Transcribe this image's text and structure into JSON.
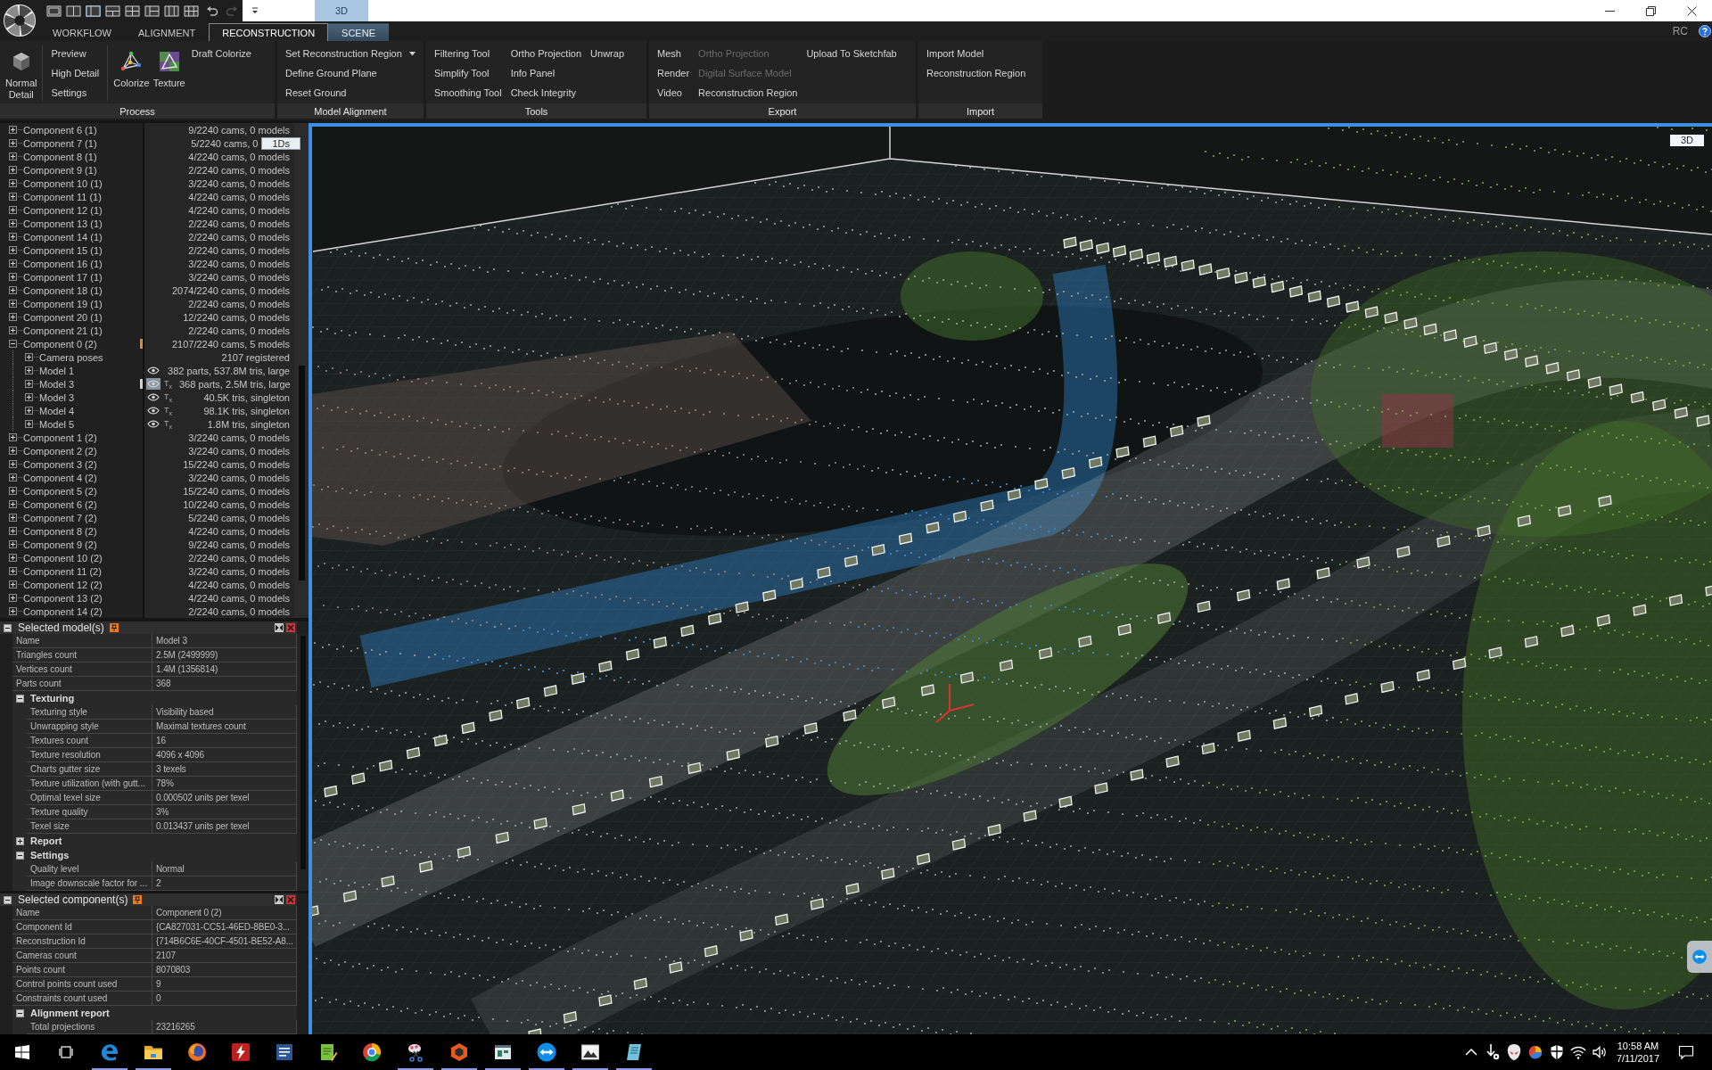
{
  "quick_access": {
    "layouts": [
      {
        "selected": false
      },
      {
        "selected": false
      },
      {
        "selected": true
      },
      {
        "selected": false
      },
      {
        "selected": false
      },
      {
        "selected": false
      },
      {
        "selected": false
      },
      {
        "selected": false
      }
    ],
    "history": [
      {
        "disabled": false
      },
      {
        "disabled": true
      }
    ]
  },
  "context_tab_group": {
    "label": "3D"
  },
  "tabs": [
    {
      "label": "WORKFLOW",
      "selected": false,
      "contextual": false
    },
    {
      "label": "ALIGNMENT",
      "selected": false,
      "contextual": false
    },
    {
      "label": "RECONSTRUCTION",
      "selected": true,
      "contextual": false
    },
    {
      "label": "SCENE",
      "selected": false,
      "contextual": true
    }
  ],
  "app_badge": "RC",
  "ribbon": {
    "groups": [
      {
        "label": "Process",
        "items": [
          {
            "kind": "large",
            "label": "Normal Detail"
          },
          {
            "kind": "separator"
          },
          {
            "kind": "stack",
            "buttons": [
              {
                "label": "Preview",
                "kind": "button",
                "disabled": false
              },
              {
                "label": "High Detail",
                "kind": "button",
                "disabled": false
              },
              {
                "label": "Settings",
                "kind": "button",
                "disabled": false
              }
            ]
          },
          {
            "kind": "separator"
          },
          {
            "kind": "large",
            "label": "Colorize"
          },
          {
            "kind": "large",
            "label": "Texture"
          },
          {
            "kind": "stack",
            "buttons": [
              {
                "label": "Draft Colorize",
                "kind": "button",
                "disabled": false
              }
            ]
          }
        ]
      },
      {
        "label": "Model Alignment",
        "items": [
          {
            "kind": "stack",
            "buttons": [
              {
                "label": "Set Reconstruction Region",
                "kind": "dropdown",
                "disabled": false
              },
              {
                "label": "Define Ground Plane",
                "kind": "button",
                "disabled": false
              },
              {
                "label": "Reset Ground",
                "kind": "button",
                "disabled": false
              }
            ]
          }
        ]
      },
      {
        "label": "Tools",
        "items": [
          {
            "kind": "stack",
            "buttons": [
              {
                "label": "Filtering Tool",
                "kind": "button",
                "disabled": false
              },
              {
                "label": "Simplify Tool",
                "kind": "button",
                "disabled": false
              },
              {
                "label": "Smoothing Tool",
                "kind": "button",
                "disabled": false
              }
            ]
          },
          {
            "kind": "stack",
            "buttons": [
              {
                "label": "Ortho Projection",
                "kind": "button",
                "disabled": false
              },
              {
                "label": "Info Panel",
                "kind": "button",
                "disabled": false
              },
              {
                "label": "Check Integrity",
                "kind": "button",
                "disabled": false
              }
            ]
          },
          {
            "kind": "stack",
            "buttons": [
              {
                "label": "Unwrap",
                "kind": "button",
                "disabled": false
              }
            ]
          }
        ]
      },
      {
        "label": "Export",
        "items": [
          {
            "kind": "stack",
            "buttons": [
              {
                "label": "Mesh",
                "kind": "button",
                "disabled": false
              },
              {
                "label": "Render",
                "kind": "button",
                "disabled": false
              },
              {
                "label": "Video",
                "kind": "button",
                "disabled": false
              }
            ]
          },
          {
            "kind": "stack",
            "buttons": [
              {
                "label": "Ortho Projection",
                "kind": "button",
                "disabled": true
              },
              {
                "label": "Digital Surface Model",
                "kind": "button",
                "disabled": true
              },
              {
                "label": "Reconstruction Region",
                "kind": "button",
                "disabled": false
              }
            ]
          },
          {
            "kind": "stack",
            "buttons": [
              {
                "label": "Upload To Sketchfab",
                "kind": "button",
                "disabled": false
              }
            ]
          }
        ]
      },
      {
        "label": "Import",
        "items": [
          {
            "kind": "stack",
            "buttons": [
              {
                "label": "Import Model",
                "kind": "button",
                "disabled": false
              },
              {
                "label": "Reconstruction Region",
                "kind": "button",
                "disabled": false
              }
            ]
          }
        ]
      }
    ]
  },
  "tree": {
    "rows": [
      {
        "label": "Component 6 (1)",
        "info": "9/2240 cams, 0 models",
        "expanded": false,
        "selected": false
      },
      {
        "label": "Component 7 (1)",
        "info": "5/2240 cams, 0",
        "tooltip": "1Ds",
        "expanded": false,
        "selected": false
      },
      {
        "label": "Component 8 (1)",
        "info": "4/2240 cams, 0 models",
        "expanded": false,
        "selected": false
      },
      {
        "label": "Component 9 (1)",
        "info": "2/2240 cams, 0 models",
        "expanded": false,
        "selected": false
      },
      {
        "label": "Component 10 (1)",
        "info": "3/2240 cams, 0 models",
        "expanded": false,
        "selected": false
      },
      {
        "label": "Component 11 (1)",
        "info": "4/2240 cams, 0 models",
        "expanded": false,
        "selected": false
      },
      {
        "label": "Component 12 (1)",
        "info": "4/2240 cams, 0 models",
        "expanded": false,
        "selected": false
      },
      {
        "label": "Component 13 (1)",
        "info": "2/2240 cams, 0 models",
        "expanded": false,
        "selected": false
      },
      {
        "label": "Component 14 (1)",
        "info": "2/2240 cams, 0 models",
        "expanded": false,
        "selected": false
      },
      {
        "label": "Component 15 (1)",
        "info": "2/2240 cams, 0 models",
        "expanded": false,
        "selected": false
      },
      {
        "label": "Component 16 (1)",
        "info": "3/2240 cams, 0 models",
        "expanded": false,
        "selected": false
      },
      {
        "label": "Component 17 (1)",
        "info": "3/2240 cams, 0 models",
        "expanded": false,
        "selected": false
      },
      {
        "label": "Component 18 (1)",
        "info": "2074/2240 cams, 0 models",
        "expanded": false,
        "selected": false
      },
      {
        "label": "Component 19 (1)",
        "info": "2/2240 cams, 0 models",
        "expanded": false,
        "selected": false
      },
      {
        "label": "Component 20 (1)",
        "info": "12/2240 cams, 0 models",
        "expanded": false,
        "selected": false
      },
      {
        "label": "Component 21 (1)",
        "info": "2/2240 cams, 0 models",
        "expanded": false,
        "selected": false
      },
      {
        "label": "Component 0 (2)",
        "info": "2107/2240 cams, 5 models",
        "expanded": true,
        "selected": true,
        "children": [
          {
            "kind": "poses",
            "label": "Camera poses",
            "info": "2107 registered",
            "expanded": false,
            "selected": false
          },
          {
            "kind": "model",
            "label": "Model 1",
            "info": "382 parts, 537.8M tris, large",
            "expanded": false,
            "selected": false,
            "visible": true
          },
          {
            "kind": "model",
            "label": "Model 3",
            "info": "368 parts, 2.5M tris, large",
            "expanded": false,
            "selected": true,
            "visible": true,
            "badge": "T$_{x}$"
          },
          {
            "kind": "model",
            "label": "Model 3",
            "info": "40.5K tris, singleton",
            "expanded": false,
            "selected": false,
            "visible": true,
            "badge": "T$_{x}$"
          },
          {
            "kind": "model",
            "label": "Model 4",
            "info": "98.1K tris, singleton",
            "expanded": false,
            "selected": false,
            "visible": true,
            "badge": "T$_{x}$"
          },
          {
            "kind": "model",
            "label": "Model 5",
            "info": "1.8M tris, singleton",
            "expanded": false,
            "selected": false,
            "visible": true,
            "badge": "T$_{x}$"
          }
        ]
      },
      {
        "label": "Component 1 (2)",
        "info": "3/2240 cams, 0 models",
        "expanded": false,
        "selected": false
      },
      {
        "label": "Component 2 (2)",
        "info": "3/2240 cams, 0 models",
        "expanded": false,
        "selected": false
      },
      {
        "label": "Component 3 (2)",
        "info": "15/2240 cams, 0 models",
        "expanded": false,
        "selected": false
      },
      {
        "label": "Component 4 (2)",
        "info": "3/2240 cams, 0 models",
        "expanded": false,
        "selected": false
      },
      {
        "label": "Component 5 (2)",
        "info": "15/2240 cams, 0 models",
        "expanded": false,
        "selected": false
      },
      {
        "label": "Component 6 (2)",
        "info": "10/2240 cams, 0 models",
        "expanded": false,
        "selected": false
      },
      {
        "label": "Component 7 (2)",
        "info": "5/2240 cams, 0 models",
        "expanded": false,
        "selected": false
      },
      {
        "label": "Component 8 (2)",
        "info": "4/2240 cams, 0 models",
        "expanded": false,
        "selected": false
      },
      {
        "label": "Component 9 (2)",
        "info": "9/2240 cams, 0 models",
        "expanded": false,
        "selected": false
      },
      {
        "label": "Component 10 (2)",
        "info": "2/2240 cams, 0 models",
        "expanded": false,
        "selected": false
      },
      {
        "label": "Component 11 (2)",
        "info": "3/2240 cams, 0 models",
        "expanded": false,
        "selected": false
      },
      {
        "label": "Component 12 (2)",
        "info": "4/2240 cams, 0 models",
        "expanded": false,
        "selected": false
      },
      {
        "label": "Component 13 (2)",
        "info": "4/2240 cams, 0 models",
        "expanded": false,
        "selected": false
      },
      {
        "label": "Component 14 (2)",
        "info": "2/2240 cams, 0 models",
        "expanded": false,
        "selected": false
      }
    ]
  },
  "panels": [
    {
      "title": "Selected model(s)",
      "expanded": true,
      "rows": [
        {
          "kind": "property",
          "label": "Name",
          "value": "Model 3"
        },
        {
          "kind": "property",
          "label": "Triangles count",
          "value": "2.5M (2499999)"
        },
        {
          "kind": "property",
          "label": "Vertices count",
          "value": "1.4M (1356814)"
        },
        {
          "kind": "property",
          "label": "Parts count",
          "value": "368"
        },
        {
          "kind": "section",
          "label": "Texturing",
          "expanded": true,
          "children": [
            {
              "kind": "property",
              "label": "Texturing style",
              "value": "Visibility based"
            },
            {
              "kind": "property",
              "label": "Unwrapping style",
              "value": "Maximal textures count"
            },
            {
              "kind": "property",
              "label": "Textures count",
              "value": "16"
            },
            {
              "kind": "property",
              "label": "Texture resolution",
              "value": "4096 x 4096"
            },
            {
              "kind": "property",
              "label": "Charts gutter size",
              "value": "3 texels"
            },
            {
              "kind": "property",
              "label": "Texture utilization (with gutt...",
              "value": "78%"
            },
            {
              "kind": "property",
              "label": "Optimal texel size",
              "value": "0.000502 units per texel"
            },
            {
              "kind": "property",
              "label": "Texture quality",
              "value": "3%"
            },
            {
              "kind": "property",
              "label": "Texel size",
              "value": "0.013437 units per texel"
            }
          ]
        },
        {
          "kind": "section",
          "label": "Report",
          "expanded": false
        },
        {
          "kind": "section",
          "label": "Settings",
          "expanded": true,
          "children": [
            {
              "kind": "property",
              "label": "Quality level",
              "value": "Normal"
            },
            {
              "kind": "property",
              "label": "Image downscale factor for ...",
              "value": "2"
            }
          ]
        }
      ]
    },
    {
      "title": "Selected component(s)",
      "expanded": true,
      "rows": [
        {
          "kind": "property",
          "label": "Name",
          "value": "Component 0 (2)"
        },
        {
          "kind": "property",
          "label": "Component Id",
          "value": "{CA827031-CC51-46ED-8BE0-3..."
        },
        {
          "kind": "property",
          "label": "Reconstruction Id",
          "value": "{714B6C6E-40CF-4501-BE52-A8..."
        },
        {
          "kind": "property",
          "label": "Cameras count",
          "value": "2107"
        },
        {
          "kind": "property",
          "label": "Points count",
          "value": "8070803"
        },
        {
          "kind": "property",
          "label": "Control points count used",
          "value": "9"
        },
        {
          "kind": "property",
          "label": "Constraints count used",
          "value": "0"
        },
        {
          "kind": "section",
          "label": "Alignment report",
          "expanded": true,
          "children": [
            {
              "kind": "property",
              "label": "Total projections",
              "value": "23216265"
            }
          ]
        }
      ]
    }
  ],
  "viewport": {
    "label": "3D"
  },
  "taskbar": {
    "apps": [
      {
        "running": true
      },
      {
        "running": true
      },
      {
        "running": false
      },
      {
        "running": false
      },
      {
        "running": false
      },
      {
        "running": false
      },
      {
        "running": false
      },
      {
        "running": true
      },
      {
        "running": true
      },
      {
        "running": true
      },
      {
        "running": true
      },
      {
        "running": true
      },
      {
        "running": true
      }
    ],
    "time": "10:58 AM",
    "date": "7/11/2017"
  }
}
